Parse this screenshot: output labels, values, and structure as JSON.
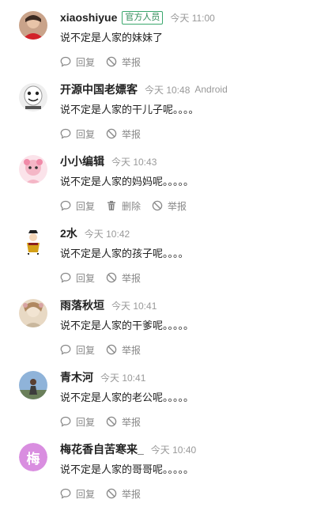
{
  "comments": [
    {
      "user": "xiaoshiyue",
      "badge": "官方人员",
      "time": "今天 11:00",
      "device": "",
      "text": "说不定是人家的妹妹了",
      "reply": "回复",
      "delete": "",
      "report": "举报",
      "avatar": "avatar-red-photo"
    },
    {
      "user": "开源中国老嫖客",
      "badge": "",
      "time": "今天 10:48",
      "device": "Android",
      "text": "说不定是人家的干儿子呢。。。。",
      "reply": "回复",
      "delete": "",
      "report": "举报",
      "avatar": "avatar-meme-face"
    },
    {
      "user": "小小编辑",
      "badge": "",
      "time": "今天 10:43",
      "device": "",
      "text": "说不定是人家的妈妈呢。。。。。",
      "reply": "回复",
      "delete": "删除",
      "report": "举报",
      "avatar": "avatar-pink-doll"
    },
    {
      "user": "2水",
      "badge": "",
      "time": "今天 10:42",
      "device": "",
      "text": "说不定是人家的孩子呢。。。。",
      "reply": "回复",
      "delete": "",
      "report": "举报",
      "avatar": "avatar-cartoon-figure"
    },
    {
      "user": "雨落秋垣",
      "badge": "",
      "time": "今天 10:41",
      "device": "",
      "text": "说不定是人家的干爹呢。。。。。",
      "reply": "回复",
      "delete": "",
      "report": "举报",
      "avatar": "avatar-beige-photo"
    },
    {
      "user": "青木河",
      "badge": "",
      "time": "今天 10:41",
      "device": "",
      "text": "说不定是人家的老公呢。。。。。",
      "reply": "回复",
      "delete": "",
      "report": "举报",
      "avatar": "avatar-landscape-photo"
    },
    {
      "user": "梅花香自苦寒来_",
      "badge": "",
      "time": "今天 10:40",
      "device": "",
      "text": "说不定是人家的哥哥呢。。。。。",
      "reply": "回复",
      "delete": "",
      "report": "举报",
      "avatar": "avatar-letter",
      "avatar_letter": "梅"
    }
  ],
  "colors": {
    "badge": "#3aa76d",
    "letter_avatar": "#d98ee0",
    "muted": "#999999"
  }
}
